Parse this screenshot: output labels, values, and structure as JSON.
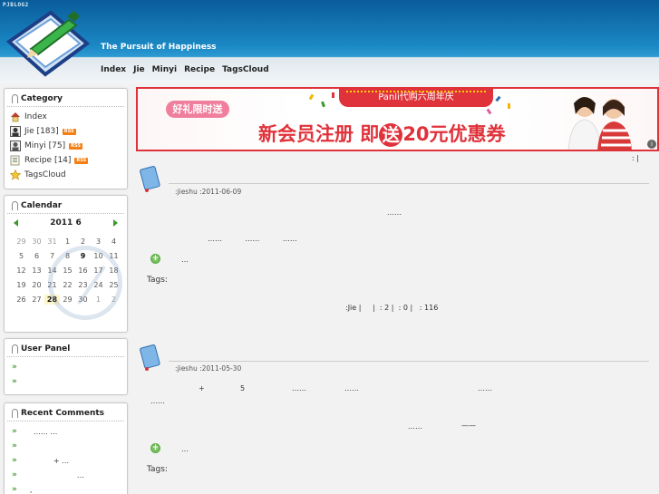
{
  "header": {
    "brand": "PJBLOG2",
    "tagline": "The Pursuit of Happiness",
    "nav": [
      "Index",
      "Jie",
      "Minyi",
      "Recipe",
      "TagsCloud"
    ]
  },
  "sidebar": {
    "category": {
      "title": "Category",
      "items": [
        {
          "label": "Index",
          "rss": ""
        },
        {
          "label": "Jie [183]",
          "rss": "RSS"
        },
        {
          "label": "Minyi [75]",
          "rss": "RSS"
        },
        {
          "label": "Recipe [14]",
          "rss": "RSS"
        },
        {
          "label": "TagsCloud",
          "rss": ""
        }
      ]
    },
    "calendar": {
      "title": "Calendar",
      "month_label": "2011  6",
      "days": [
        "29",
        "30",
        "31",
        "1",
        "2",
        "3",
        "4",
        "5",
        "6",
        "7",
        "8",
        "9",
        "10",
        "11",
        "12",
        "13",
        "14",
        "15",
        "16",
        "17",
        "18",
        "19",
        "20",
        "21",
        "22",
        "23",
        "24",
        "25",
        "26",
        "27",
        "28",
        "29",
        "30",
        "1",
        "2"
      ]
    },
    "user_panel": {
      "title": "User Panel"
    },
    "recent_comments": {
      "title": "Recent Comments",
      "items": [
        "……        …",
        "",
        "+    …",
        "…",
        ","
      ]
    }
  },
  "banner": {
    "pill_left": "好礼限时送",
    "pill_top": "Panli代购六周年庆",
    "promo_before": "新会员注册 即",
    "promo_circle": "送",
    "promo_after": "20元优惠券",
    "info": "i"
  },
  "content": {
    "top_right": ":   |",
    "posts": [
      {
        "meta": ":jieshu   :2011-06-09",
        "lines": [
          "……",
          "……          ……          ……"
        ],
        "more": "…",
        "tags": "Tags:",
        "footer": ":Jie |     |  : 2 |  : 0 |   : 116"
      },
      {
        "meta": ":jieshu   :2011-05-30",
        "line1a": "+",
        "line1b": "5",
        "line1c": "……",
        "line1d": "……",
        "line1e": "……",
        "line2": "……",
        "line3": "……",
        "line3b": "——",
        "more": "…",
        "tags": "Tags:"
      }
    ]
  },
  "colors": {
    "header_blue": "#1a88c4",
    "accent_green": "#3d9a2a",
    "banner_red": "#e0323a",
    "rss_orange": "#f57f13"
  }
}
